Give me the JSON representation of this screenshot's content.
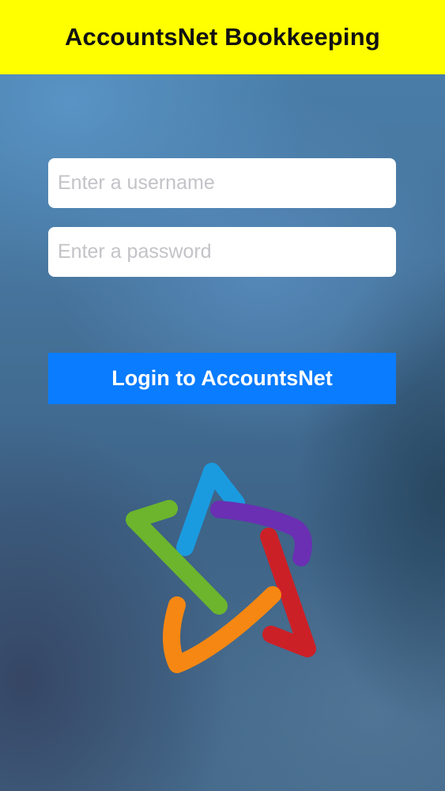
{
  "header": {
    "title": "AccountsNet Bookkeeping",
    "background_color": "#ffff00"
  },
  "login_form": {
    "username_placeholder": "Enter a username",
    "username_value": "",
    "password_placeholder": "Enter a password",
    "password_value": "",
    "login_button_label": "Login to AccountsNet",
    "login_button_color": "#0a7cff"
  },
  "logo": {
    "icon": "five-color-star-logo-icon",
    "colors": [
      "#1a9be0",
      "#6a2fb3",
      "#cc2027",
      "#f68712",
      "#6cb52d"
    ]
  }
}
